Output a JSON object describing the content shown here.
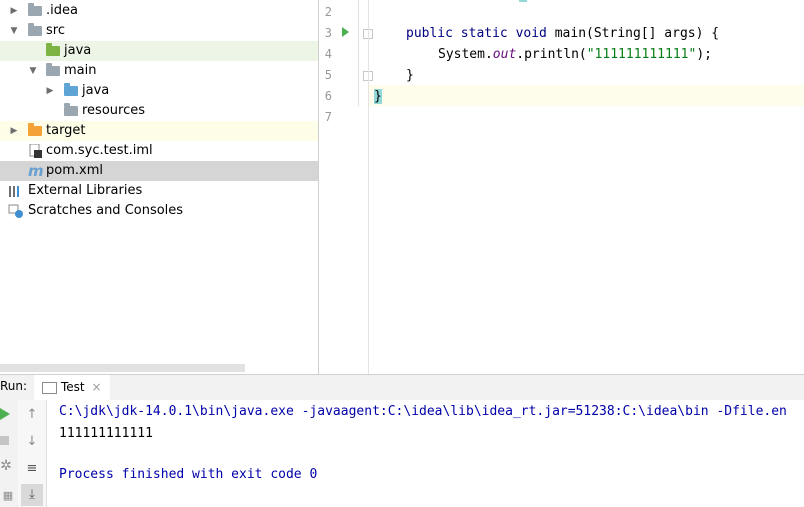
{
  "project_tree": {
    "items": [
      {
        "label": ".idea",
        "icon": "folder-icon",
        "indent": 0,
        "arrow": "collapsed"
      },
      {
        "label": "src",
        "icon": "folder-icon",
        "indent": 0,
        "arrow": "expanded"
      },
      {
        "label": "java",
        "icon": "folder-icon",
        "indent": 1,
        "arrow": "none"
      },
      {
        "label": "main",
        "icon": "folder-icon",
        "indent": 1,
        "arrow": "expanded"
      },
      {
        "label": "java",
        "icon": "folder-icon",
        "indent": 2,
        "arrow": "collapsed"
      },
      {
        "label": "resources",
        "icon": "resources-folder-icon",
        "indent": 2,
        "arrow": "none"
      },
      {
        "label": "target",
        "icon": "folder-icon",
        "indent": 0,
        "arrow": "collapsed"
      },
      {
        "label": "com.syc.test.iml",
        "icon": "iml-file-icon",
        "indent": 0,
        "arrow": "none"
      },
      {
        "label": "pom.xml",
        "icon": "maven-icon",
        "indent": 0,
        "arrow": "none"
      },
      {
        "label": "External Libraries",
        "icon": "libraries-icon",
        "indent": -1,
        "arrow": "none"
      },
      {
        "label": "Scratches and Consoles",
        "icon": "scratches-icon",
        "indent": -1,
        "arrow": "none"
      }
    ]
  },
  "editor": {
    "line_numbers": [
      "2",
      "3",
      "4",
      "5",
      "6",
      "7"
    ],
    "code": {
      "line3_kw": "public static void ",
      "line3_method": "main",
      "line3_rest": "(String[] args) {",
      "line4_pre": "System.",
      "line4_field": "out",
      "line4_call": ".println(",
      "line4_str": "\"111111111111\"",
      "line4_end": ");",
      "line5": "}",
      "line6": "}"
    }
  },
  "run_panel": {
    "label": "Run:",
    "tab": "Test",
    "tab_close": "×",
    "console": {
      "command": "C:\\jdk\\jdk-14.0.1\\bin\\java.exe -javaagent:C:\\idea\\lib\\idea_rt.jar=51238:C:\\idea\\bin -Dfile.en",
      "output": "111111111111",
      "exit": "Process finished with exit code 0"
    }
  },
  "colors": {
    "folder_blue": "#9aa7b0",
    "source_folder_blue": "#5ea5d6",
    "test_folder_green": "#7cb342",
    "excluded_orange": "#f4a236",
    "keyword": "#000080",
    "string": "#067d17",
    "field": "#660e7a"
  }
}
